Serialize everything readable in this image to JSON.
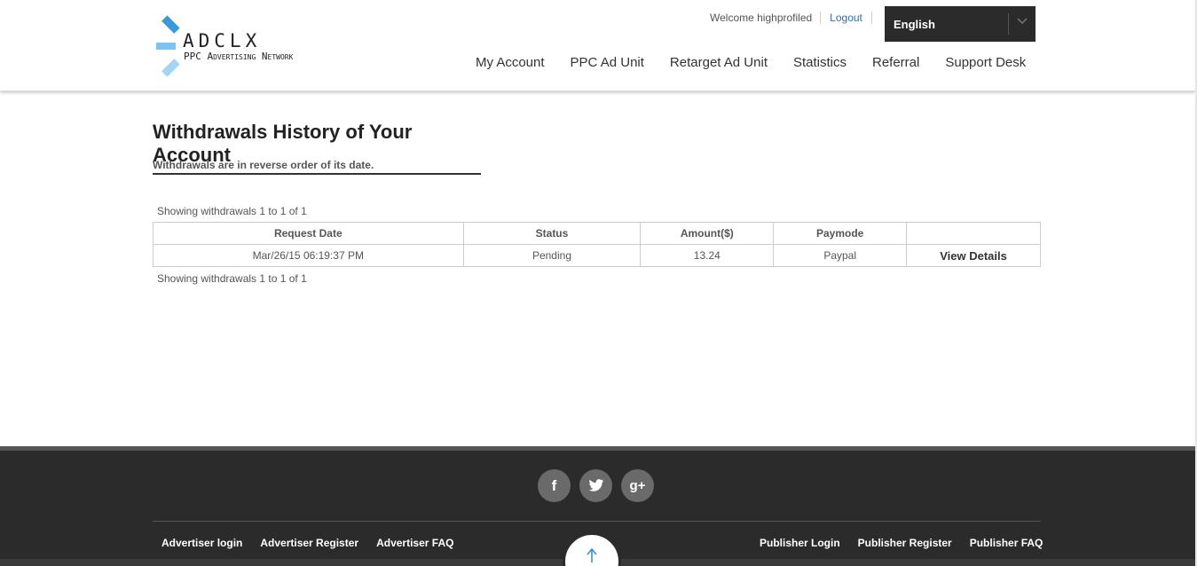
{
  "logo": {
    "name": "ADCLX",
    "tagline": "PPC Advertising Network"
  },
  "topbar": {
    "welcome": "Welcome highprofiled",
    "logout": "Logout"
  },
  "language": {
    "selected": "English"
  },
  "nav": [
    "My Account",
    "PPC Ad Unit",
    "Retarget Ad Unit",
    "Statistics",
    "Referral",
    "Support Desk"
  ],
  "main": {
    "title": "Withdrawals History of Your Account",
    "subtitle": "Withdrawals are in reverse order of its date.",
    "showing_top": "Showing withdrawals 1 to 1 of 1",
    "showing_bottom": "Showing withdrawals 1 to 1 of 1",
    "table": {
      "headers": [
        "Request Date",
        "Status",
        "Amount($)",
        "Paymode",
        ""
      ],
      "rows": [
        {
          "date": "Mar/26/15 06:19:37 PM",
          "status": "Pending",
          "amount": "13.24",
          "paymode": "Paypal",
          "action": "View Details"
        }
      ]
    }
  },
  "footer": {
    "socials": [
      "facebook-icon",
      "twitter-icon",
      "google-plus-icon"
    ],
    "social_glyphs": [
      "f",
      "t",
      "g+"
    ],
    "advertiser_links": [
      "Advertiser login",
      "Advertiser Register",
      "Advertiser FAQ"
    ],
    "publisher_links": [
      "Publisher Login",
      "Publisher Register",
      "Publisher FAQ"
    ]
  },
  "colors": {
    "accent": "#3a9ad9",
    "footer_bg": "#2b2b2b",
    "link": "#2a6fb0"
  }
}
